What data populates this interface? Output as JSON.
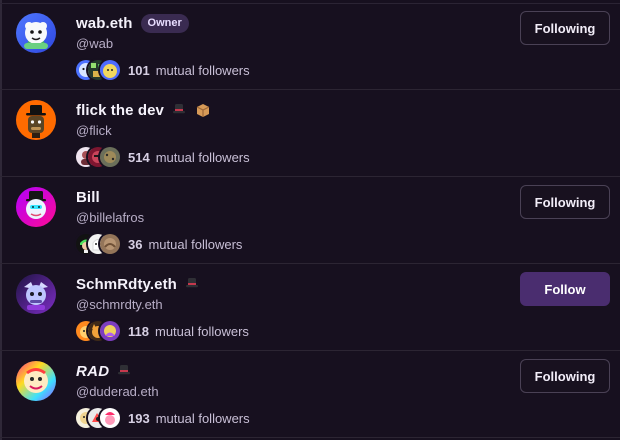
{
  "profiles": [
    {
      "display_name": "wab.eth",
      "handle": "@wab",
      "badge": "Owner",
      "mutual_count": "101",
      "mutual_label": "mutual followers",
      "action": "Following",
      "avatar_icon": "white-bear-avatar-icon",
      "mini_avatar_icons": [
        "blue-face-avatar-icon",
        "green-pixel-avatar-icon",
        "yellow-cartoon-avatar-icon"
      ]
    },
    {
      "display_name": "flick the dev",
      "handle": "@flick",
      "badge": "",
      "mutual_count": "514",
      "mutual_label": "mutual followers",
      "action": "",
      "avatar_icon": "top-hat-bear-avatar-icon",
      "emojis": [
        "top-hat-icon",
        "package-icon"
      ],
      "mini_avatar_icons": [
        "pink-person-avatar-icon",
        "red-mask-avatar-icon",
        "gray-pattern-avatar-icon"
      ]
    },
    {
      "display_name": "Bill",
      "handle": "@billelafros",
      "badge": "",
      "mutual_count": "36",
      "mutual_label": "mutual followers",
      "action": "Following",
      "avatar_icon": "top-hat-snowman-avatar-icon",
      "mini_avatar_icons": [
        "green-hair-avatar-icon",
        "white-ghost-avatar-icon",
        "brown-brush-avatar-icon"
      ]
    },
    {
      "display_name": "SchmRdty.eth",
      "handle": "@schmrdty.eth",
      "badge": "",
      "mutual_count": "118",
      "mutual_label": "mutual followers",
      "action": "Follow",
      "avatar_icon": "purple-creature-avatar-icon",
      "emojis": [
        "top-hat-icon"
      ],
      "mini_avatar_icons": [
        "orange-character-avatar-icon",
        "cat-avatar-icon",
        "purple-art-avatar-icon"
      ]
    },
    {
      "display_name": "RAD",
      "handle": "@duderad.eth",
      "badge": "",
      "mutual_count": "193",
      "mutual_label": "mutual followers",
      "action": "Following",
      "avatar_icon": "rainbow-face-avatar-icon",
      "emojis": [
        "top-hat-icon"
      ],
      "mini_avatar_icons": [
        "bright-face-avatar-icon",
        "red-drawing-avatar-icon",
        "pink-hat-avatar-icon"
      ]
    }
  ],
  "colors": {
    "background": "#17101f",
    "follow_button": "#4a2d6f",
    "badge": "#3a2b51"
  }
}
